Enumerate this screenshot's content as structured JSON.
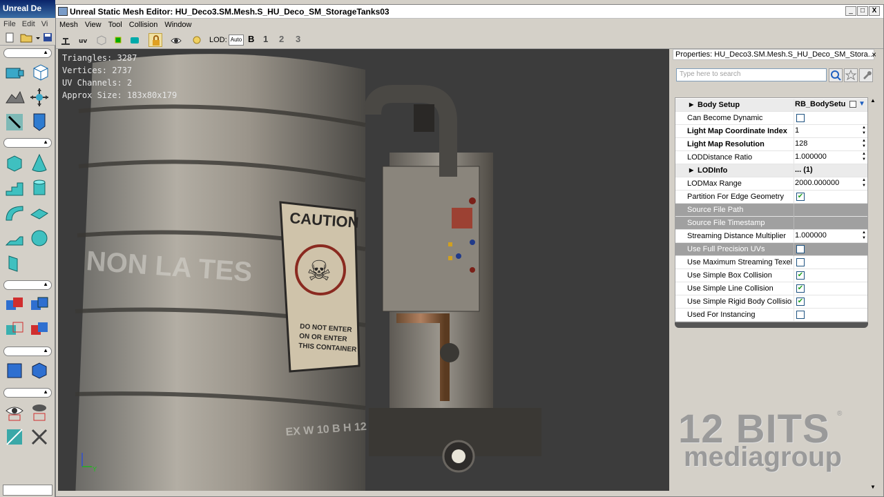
{
  "back_editor": {
    "title": "Unreal De",
    "menu": [
      "File",
      "Edit",
      "Vi"
    ]
  },
  "window": {
    "title": "Unreal Static Mesh Editor: HU_Deco3.SM.Mesh.S_HU_Deco_SM_StorageTanks03",
    "controls": [
      "_",
      "□",
      "X"
    ]
  },
  "menubar": [
    "Mesh",
    "View",
    "Tool",
    "Collision",
    "Window"
  ],
  "toolbar": {
    "lod_label": "LOD:",
    "lod_auto": "Auto",
    "lod_buttons": [
      "B",
      "1",
      "2",
      "3"
    ]
  },
  "viewport": {
    "stats": [
      "Triangles:  3287",
      "Vertices:  2737",
      "UV Channels:  2",
      "Approx Size: 183x80x179"
    ],
    "scene_text": {
      "caution": "CAUTION",
      "warning": "DO NOT ENTER\nON OR ENTER\nTHIS CONTAINER",
      "stencil1": "NON LA TES",
      "stencil2": "EX W 10 B H 12",
      "axis_y": "Y"
    }
  },
  "properties": {
    "title": "Properties: HU_Deco3.SM.Mesh.S_HU_Deco_SM_Stora...",
    "close": "×",
    "search_placeholder": "Type here to search",
    "rows": [
      {
        "name": "Body Setup",
        "value": "RB_BodySetu",
        "type": "header"
      },
      {
        "name": "Can Become Dynamic",
        "value": "",
        "type": "check",
        "checked": false
      },
      {
        "name": "Light Map Coordinate Index",
        "value": "1",
        "type": "bold-spin"
      },
      {
        "name": "Light Map Resolution",
        "value": "128",
        "type": "bold-spin"
      },
      {
        "name": "LODDistance Ratio",
        "value": "1.000000",
        "type": "spin"
      },
      {
        "name": "LODInfo",
        "value": "... (1)",
        "type": "header"
      },
      {
        "name": "LODMax Range",
        "value": "2000.000000",
        "type": "spin"
      },
      {
        "name": "Partition For Edge Geometry",
        "value": "",
        "type": "check",
        "checked": true
      },
      {
        "name": "Source File Path",
        "value": "",
        "type": "grey"
      },
      {
        "name": "Source File Timestamp",
        "value": "",
        "type": "grey"
      },
      {
        "name": "Streaming Distance Multiplier",
        "value": "1.000000",
        "type": "spin"
      },
      {
        "name": "Use Full Precision UVs",
        "value": "",
        "type": "grey-check",
        "checked": false
      },
      {
        "name": "Use Maximum Streaming Texel Ratio",
        "value": "",
        "type": "check",
        "checked": false
      },
      {
        "name": "Use Simple Box Collision",
        "value": "",
        "type": "check",
        "checked": true
      },
      {
        "name": "Use Simple Line Collision",
        "value": "",
        "type": "check",
        "checked": true
      },
      {
        "name": "Use Simple Rigid Body Collision",
        "value": "",
        "type": "check",
        "checked": true
      },
      {
        "name": "Used For Instancing",
        "value": "",
        "type": "check",
        "checked": false
      }
    ]
  },
  "watermark": {
    "line1": "12 BITS",
    "line2": "mediagroup",
    "mark": "®"
  },
  "colors": {
    "viewport_bg": "#3c3c3c",
    "grey_row": "#a0a0a0",
    "check": "#21a121"
  }
}
